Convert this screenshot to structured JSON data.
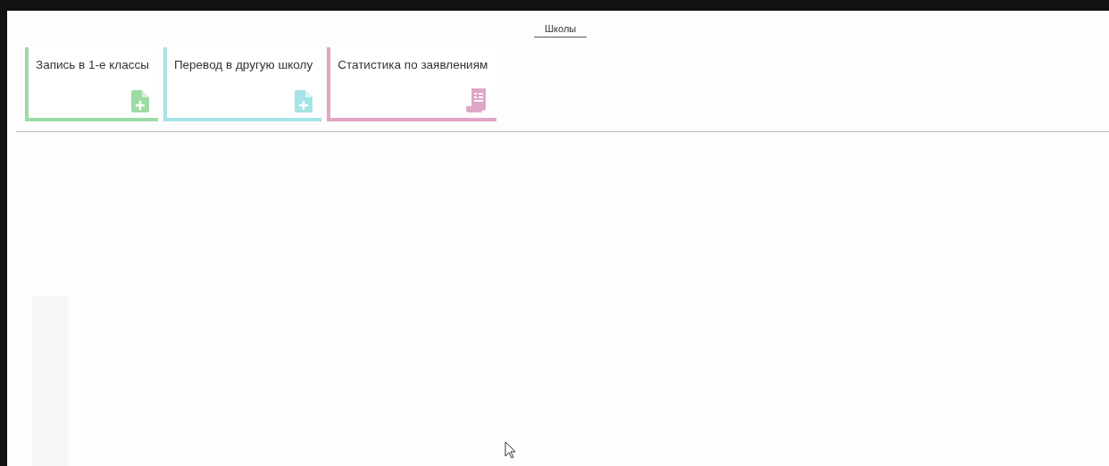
{
  "tabs": [
    {
      "label": "Школы",
      "selected": true
    }
  ],
  "cards": [
    {
      "title": "Запись в 1-е классы",
      "color": "#9ddba4",
      "kind": "file-plus"
    },
    {
      "title": "Перевод в другую школу",
      "color": "#a4e4e6",
      "kind": "file-plus"
    },
    {
      "title": "Статистика по заявлениям",
      "color": "#e0a6c6",
      "kind": "receipt"
    }
  ]
}
